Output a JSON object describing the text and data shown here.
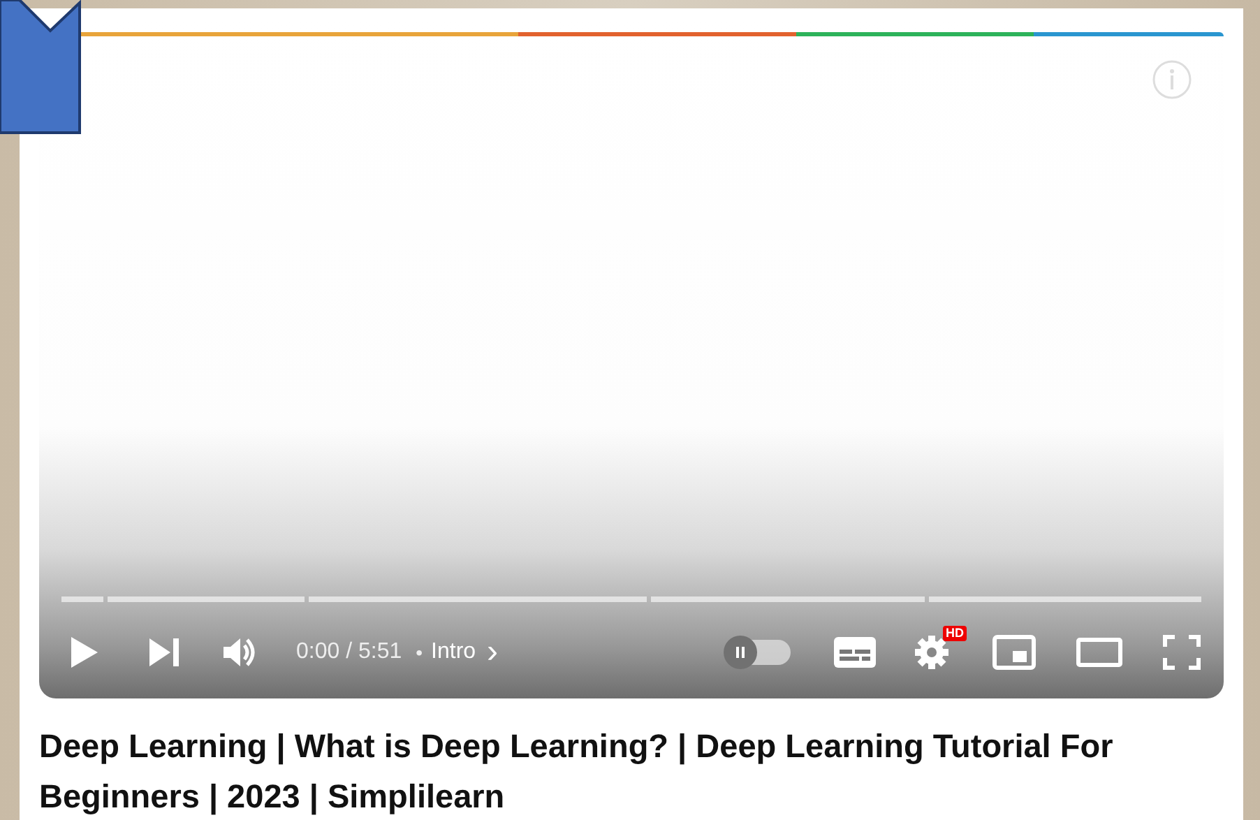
{
  "player": {
    "time": "0:00 / 5:51",
    "separator": "•",
    "chapter": "Intro",
    "chapter_arrow": "›",
    "autoplay": {
      "on": false
    },
    "quality_badge": "HD"
  },
  "title": "Deep Learning | What is Deep Learning? | Deep Learning Tutorial For Beginners | 2023 | Simplilearn"
}
